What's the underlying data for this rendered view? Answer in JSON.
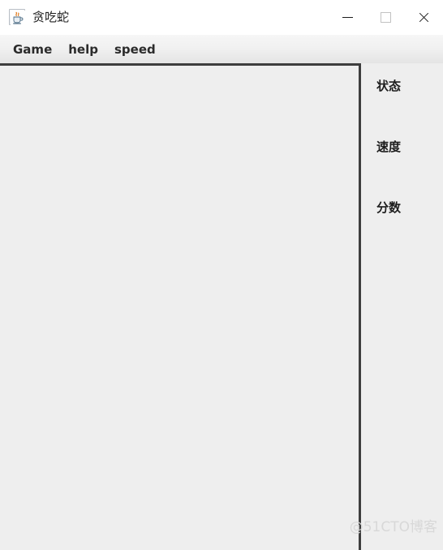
{
  "window": {
    "title": "贪吃蛇",
    "app_icon": "java-coffee-cup-icon",
    "controls": {
      "minimize": "—",
      "maximize": "□",
      "close": "✕",
      "minimize_name": "minimize-button",
      "maximize_name": "maximize-button",
      "close_name": "close-button"
    }
  },
  "menubar": {
    "items": [
      {
        "label": "Game"
      },
      {
        "label": "help"
      },
      {
        "label": "speed"
      }
    ]
  },
  "game_panel": {
    "background_color": "#eeeeee",
    "border_color": "#3d3d3d",
    "content": ""
  },
  "side_panel": {
    "background_color": "#eeeeee",
    "labels": [
      {
        "label": "状态"
      },
      {
        "label": "速度"
      },
      {
        "label": "分数"
      }
    ]
  },
  "watermark": {
    "text": "@51CTO博客",
    "color": "#d8d8d8"
  }
}
